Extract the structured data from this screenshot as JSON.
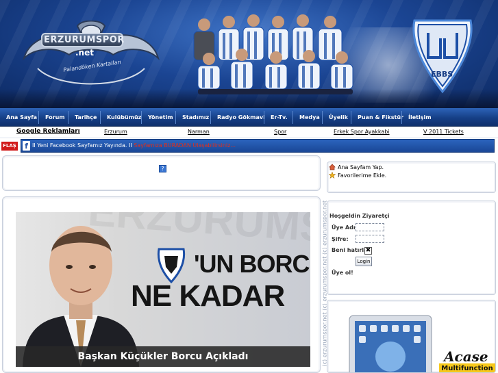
{
  "header": {
    "logo_text": "ERZURUMSPOR",
    "logo_net": ".net",
    "logo_slogan": "Palandöken Kartalları",
    "crest_text": "EBBS"
  },
  "nav": {
    "items": [
      {
        "label": "Ana Sayfa"
      },
      {
        "label": "Forum"
      },
      {
        "label": "Tarihçe"
      },
      {
        "label": "Kulübümüz"
      },
      {
        "label": "Yönetim"
      },
      {
        "label": "Stadımız"
      },
      {
        "label": "Radyo Gökmavi"
      },
      {
        "label": "Er-Tv."
      },
      {
        "label": "Medya"
      },
      {
        "label": "Üyelik"
      },
      {
        "label": "Puan & Fikstür"
      },
      {
        "label": "İletişim"
      }
    ]
  },
  "ads": {
    "title": "Google Reklamları",
    "links": [
      "Erzurum",
      "Narman",
      "Spor",
      "Erkek Spor Ayakkabi",
      "V 2011 Tickets"
    ]
  },
  "flash": {
    "badge": "FLAŞ",
    "ticker_text": "II Yeni Facebook Sayfamız Yayında. II",
    "ticker_highlight": "Sayfamıza BURADAN Ulaşabilirsiniz..."
  },
  "sidebar": {
    "watermark": "(c) erzurumspor.net   (c) erzurumspor.net   (c) erzurumspor.net",
    "quick_links": [
      "Ana Sayfam Yap.",
      "Favorilerime Ekle."
    ],
    "login": {
      "welcome": "Hoşgeldin Ziyaretçi",
      "username_label": "Üye Adı:",
      "password_label": "Şifre:",
      "remember_label": "Beni hatırla:",
      "login_button": "Login",
      "register_link": "Üye ol!"
    },
    "ad": {
      "brand": "Acase",
      "badge": "Multifunction"
    }
  },
  "news": {
    "headline_line1": "'UN BORCU",
    "headline_line2": "NE KADAR",
    "watermark": "ERZURUMSPOR",
    "caption": "Başkan Küçükler Borcu Açıkladı"
  },
  "colors": {
    "brand_blue": "#1b4593",
    "nav_blue": "#163f86",
    "flash_red": "#d11a1a"
  }
}
